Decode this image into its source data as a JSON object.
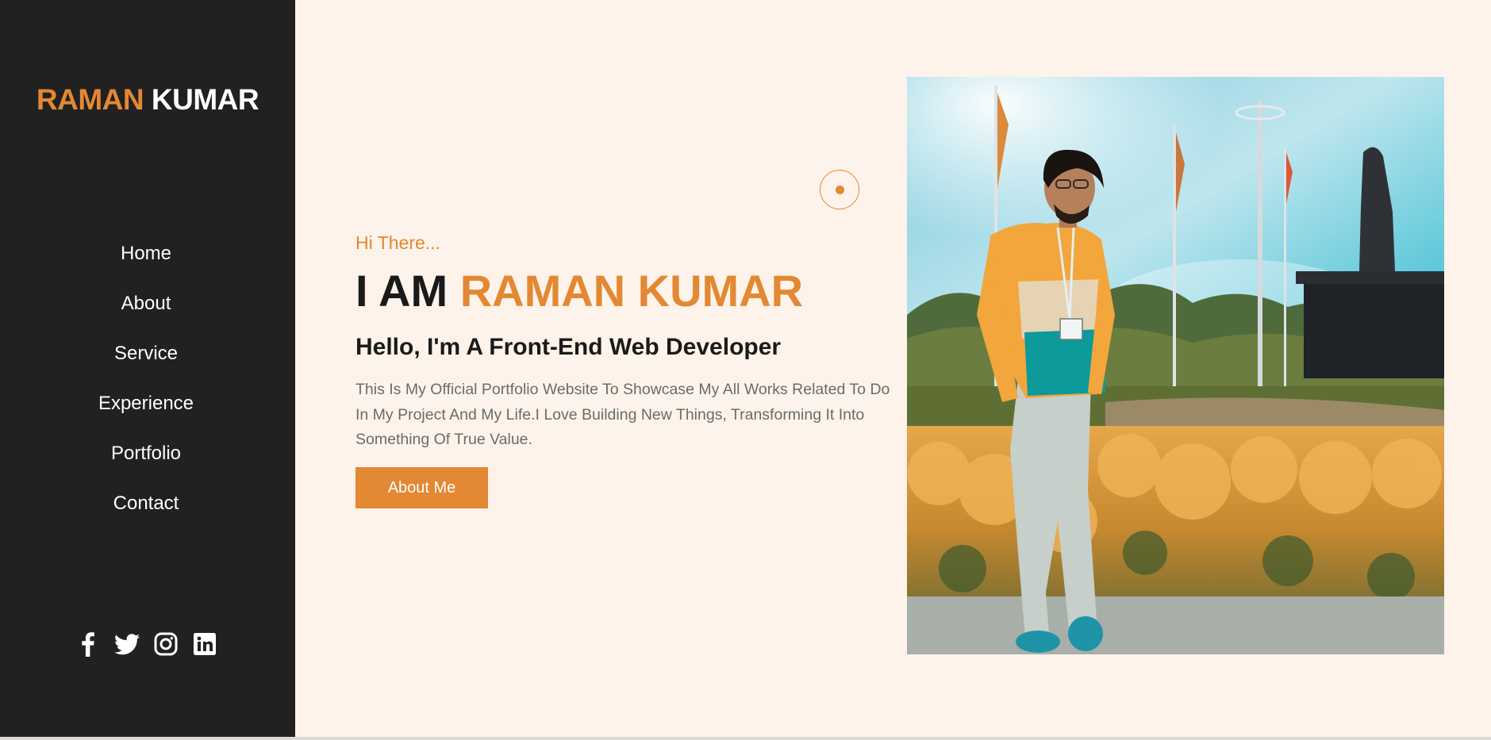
{
  "brand": {
    "first": "RAMAN",
    "last": "KUMAR"
  },
  "nav": [
    {
      "label": "Home"
    },
    {
      "label": "About"
    },
    {
      "label": "Service"
    },
    {
      "label": "Experience"
    },
    {
      "label": "Portfolio"
    },
    {
      "label": "Contact"
    }
  ],
  "social": [
    "facebook-icon",
    "twitter-icon",
    "instagram-icon",
    "linkedin-icon"
  ],
  "hero": {
    "greeting": "Hi There...",
    "headline_prefix": "I AM",
    "headline_name": "RAMAN KUMAR",
    "subtitle": "Hello, I'm A Front-End Web Developer",
    "description": "This Is My Official Portfolio Website To Showcase My All Works Related To Do In My Project And My Life.I Love Building New Things, Transforming It Into Something Of True Value.",
    "button_label": "About Me"
  },
  "colors": {
    "accent": "#e38833",
    "sidebar_bg": "#212121",
    "page_bg": "#fdf3ea"
  }
}
